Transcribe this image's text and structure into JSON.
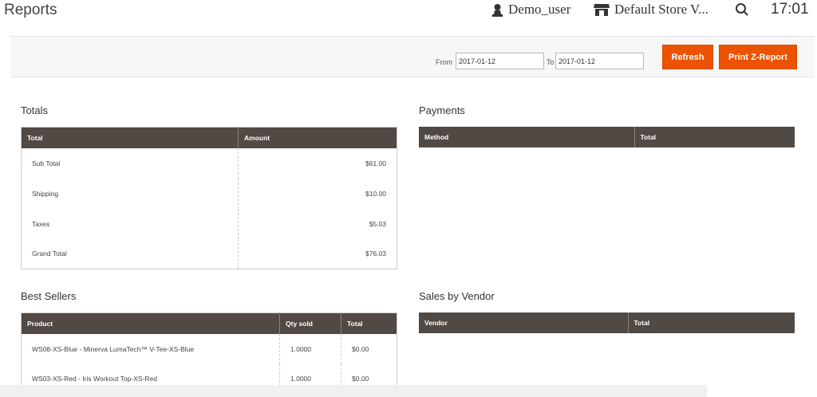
{
  "header": {
    "title": "Reports",
    "user": "Demo_user",
    "store": "Default  Store  V...",
    "time": "17:01"
  },
  "toolbar": {
    "from_label": "From",
    "from_value": "2017-01-12",
    "to_label": "To",
    "to_value": "2017-01-12",
    "refresh": "Refresh",
    "print": "Print Z-Report"
  },
  "totals": {
    "title": "Totals",
    "columns": [
      "Total",
      "Amount"
    ],
    "rows": [
      [
        "Sub Total",
        "$61.00"
      ],
      [
        "Shipping",
        "$10.00"
      ],
      [
        "Taxes",
        "$5.03"
      ],
      [
        "Grand Total",
        "$76.03"
      ]
    ]
  },
  "payments": {
    "title": "Payments",
    "columns": [
      "Method",
      "Total"
    ]
  },
  "best_sellers": {
    "title": "Best Sellers",
    "columns": [
      "Product",
      "Qty sold",
      "Total"
    ],
    "rows": [
      [
        "WS08-XS-Blue - Minerva LumaTech™ V-Tee-XS-Blue",
        "1.0000",
        "$0.00"
      ],
      [
        "WS03-XS-Red - Iris Workout Top-XS-Red",
        "1.0000",
        "$0.00"
      ]
    ]
  },
  "vendor": {
    "title": "Sales by Vendor",
    "columns": [
      "Vendor",
      "Total"
    ]
  },
  "colors": {
    "accent": "#eb5202",
    "table_header": "#514943"
  }
}
